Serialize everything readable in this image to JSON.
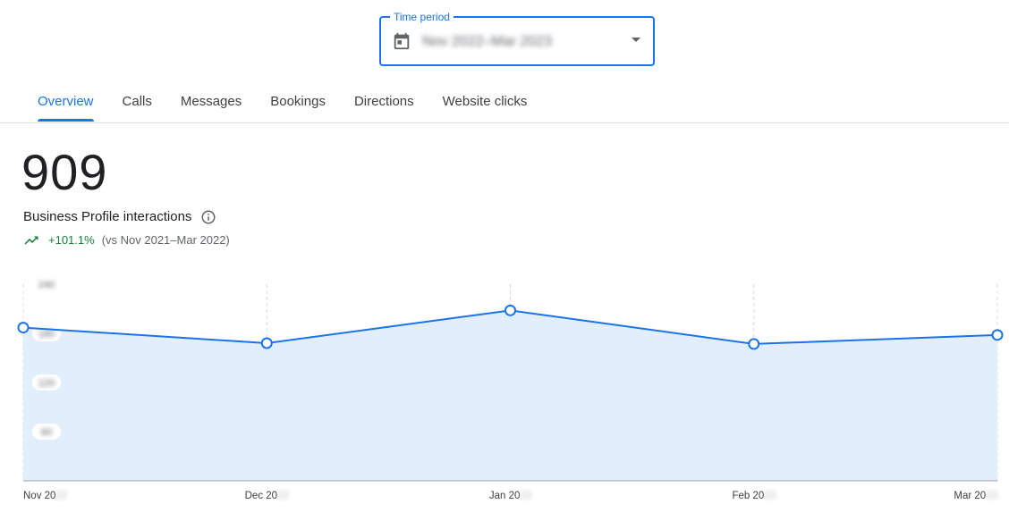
{
  "time_period": {
    "label": "Time period",
    "value": "Nov 2022–Mar 2023"
  },
  "tabs": [
    {
      "label": "Overview",
      "active": true
    },
    {
      "label": "Calls",
      "active": false
    },
    {
      "label": "Messages",
      "active": false
    },
    {
      "label": "Bookings",
      "active": false
    },
    {
      "label": "Directions",
      "active": false
    },
    {
      "label": "Website clicks",
      "active": false
    }
  ],
  "metric": {
    "value": "909",
    "label": "Business Profile interactions",
    "change": "+101.1%",
    "comparison": "(vs Nov 2021–Mar 2022)"
  },
  "icons": {
    "calendar": "calendar-icon",
    "dropdown": "arrow-drop-down-icon",
    "info": "info-icon",
    "trend": "trending-up-icon"
  },
  "colors": {
    "accent": "#1a73e8",
    "positive": "#188038",
    "area_fill": "#e3eefc"
  },
  "chart_data": {
    "type": "area",
    "x": [
      "Nov 2022",
      "Dec 2022",
      "Jan 2023",
      "Feb 2023",
      "Mar 2023"
    ],
    "x_tick_labels": [
      {
        "visible": "Nov 20",
        "obscured": "22"
      },
      {
        "visible": "Dec 20",
        "obscured": "22"
      },
      {
        "visible": "Jan 20",
        "obscured": "23"
      },
      {
        "visible": "Feb 20",
        "obscured": "23"
      },
      {
        "visible": "Mar 20",
        "obscured": "23"
      }
    ],
    "series": [
      {
        "values": [
          187,
          168,
          208,
          167,
          178
        ]
      }
    ],
    "y_ticks": [
      "240",
      "180",
      "120",
      "60"
    ],
    "y_tick_values": [
      240,
      180,
      120,
      60
    ],
    "ylim": [
      0,
      240
    ],
    "grid": "vertical dashed",
    "legend": "none"
  }
}
